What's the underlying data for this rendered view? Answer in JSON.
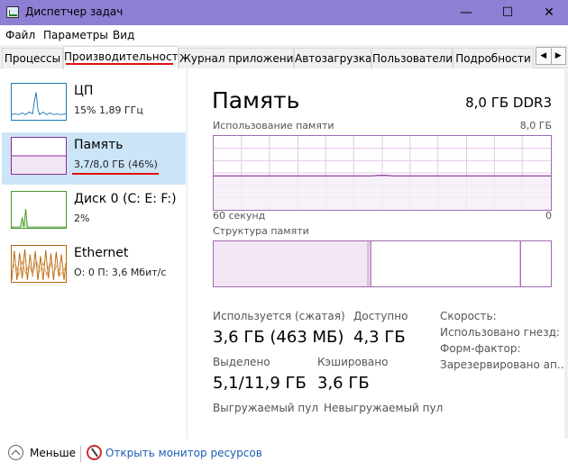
{
  "window": {
    "title": "Диспетчер задач",
    "minimize_glyph": "—",
    "maximize_glyph": "☐",
    "close_glyph": "✕"
  },
  "menu": [
    "Файл",
    "Параметры",
    "Вид"
  ],
  "tabs": [
    "Процессы",
    "Производительность",
    "Журнал приложений",
    "Автозагрузка",
    "Пользователи",
    "Подробности"
  ],
  "active_tab": "Производительность",
  "tab_scroll": {
    "left": "◀",
    "right": "▶"
  },
  "sidebar": {
    "items": [
      {
        "name": "ЦП",
        "sub": "15% 1,89 ГГц",
        "color": "#1e7ab8"
      },
      {
        "name": "Память",
        "sub": "3,7/8,0 ГБ (46%)",
        "color": "#8b2c99",
        "selected": true
      },
      {
        "name": "Диск 0 (C: E: F:)",
        "sub": "2%",
        "color": "#4a9a2a"
      },
      {
        "name": "Ethernet",
        "sub": "О: 0 П: 3,6 Мбит/с",
        "color": "#b86b10"
      }
    ]
  },
  "main": {
    "title": "Память",
    "spec": "8,0 ГБ DDR3",
    "usage_label": "Использование памяти",
    "usage_max": "8,0 ГБ",
    "time_label": "60 секунд",
    "time_min": "0",
    "structure_label": "Структура памяти",
    "usage_fraction": 0.46,
    "stats": {
      "in_use_label": "Используется (сжатая)",
      "in_use_value": "3,6 ГБ (463 МБ)",
      "available_label": "Доступно",
      "available_value": "4,3 ГБ",
      "committed_label": "Выделено",
      "committed_value": "5,1/11,9 ГБ",
      "cached_label": "Кэшировано",
      "cached_value": "3,6 ГБ",
      "paged_label": "Выгружаемый пул",
      "nonpaged_label": "Невыгружаемый пул"
    },
    "right": {
      "speed": "Скорость:",
      "slots": "Использовано гнезд:",
      "form_factor": "Форм-фактор:",
      "reserved": "Зарезервировано ап..."
    }
  },
  "footer": {
    "fewer_label": "Меньше",
    "monitor_link": "Открыть монитор ресурсов"
  },
  "colors": {
    "titlebar": "#8f7fd4",
    "memory": "#8b2c99",
    "selection": "#cce4f7",
    "highlight_red": "#e01010",
    "link": "#1a5fb4"
  }
}
